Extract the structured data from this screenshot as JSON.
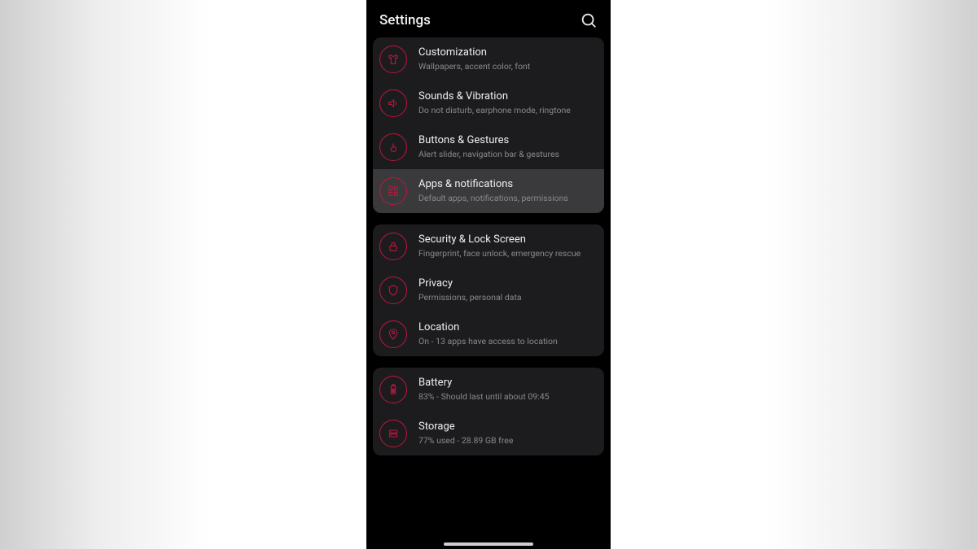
{
  "header": {
    "title": "Settings"
  },
  "groups": [
    {
      "items": [
        {
          "icon": "tshirt",
          "title": "Customization",
          "subtitle": "Wallpapers, accent color, font",
          "selected": false
        },
        {
          "icon": "volume",
          "title": "Sounds & Vibration",
          "subtitle": "Do not disturb, earphone mode, ringtone",
          "selected": false
        },
        {
          "icon": "gesture",
          "title": "Buttons & Gestures",
          "subtitle": "Alert slider, navigation bar & gestures",
          "selected": false
        },
        {
          "icon": "apps",
          "title": "Apps & notifications",
          "subtitle": "Default apps, notifications, permissions",
          "selected": true
        }
      ]
    },
    {
      "items": [
        {
          "icon": "lock",
          "title": "Security & Lock Screen",
          "subtitle": "Fingerprint, face unlock, emergency rescue",
          "selected": false
        },
        {
          "icon": "shield",
          "title": "Privacy",
          "subtitle": "Permissions, personal data",
          "selected": false
        },
        {
          "icon": "pin",
          "title": "Location",
          "subtitle": "On - 13 apps have access to location",
          "selected": false
        }
      ]
    },
    {
      "items": [
        {
          "icon": "battery",
          "title": "Battery",
          "subtitle": "83% - Should last until about 09:45",
          "selected": false
        },
        {
          "icon": "storage",
          "title": "Storage",
          "subtitle": "77% used - 28.89 GB free",
          "selected": false
        }
      ]
    }
  ]
}
